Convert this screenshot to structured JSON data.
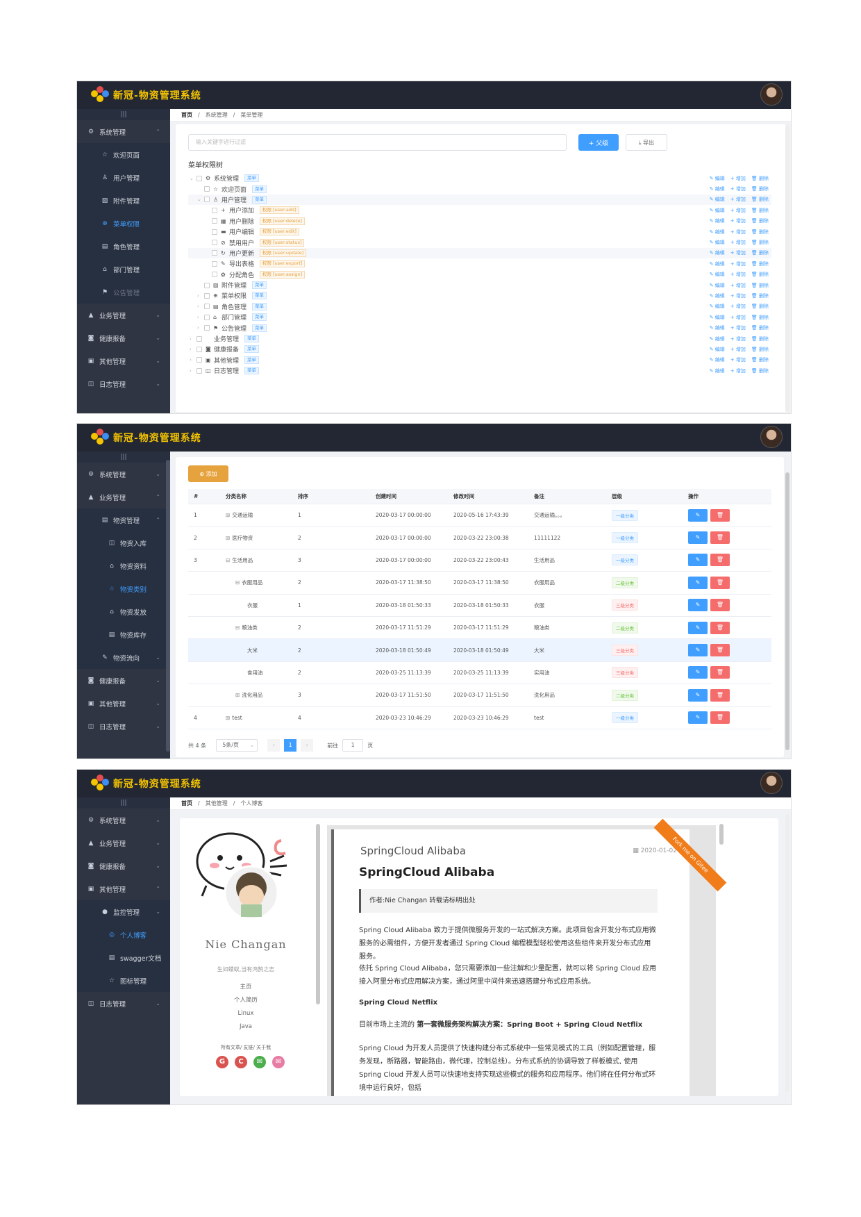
{
  "app": {
    "title": "新冠-物资管理系统"
  },
  "shot1": {
    "side_toggle": "|||",
    "menu": [
      {
        "label": "系统管理",
        "icon": "gear-icon",
        "level": 1,
        "arrow": "⌃"
      },
      {
        "label": "欢迎页面",
        "icon": "star-icon",
        "level": 2
      },
      {
        "label": "用户管理",
        "icon": "user-icon",
        "level": 2
      },
      {
        "label": "附件管理",
        "icon": "image-icon",
        "level": 2
      },
      {
        "label": "菜单权限",
        "icon": "globe-icon",
        "level": 2,
        "active": true
      },
      {
        "label": "角色管理",
        "icon": "id-card-icon",
        "level": 2
      },
      {
        "label": "部门管理",
        "icon": "home-icon",
        "level": 2
      },
      {
        "label": "公告管理",
        "icon": "flag-icon",
        "level": 2,
        "disabled": true
      },
      {
        "label": "业务管理",
        "icon": "bag-icon",
        "level": 1,
        "arrow": "⌄"
      },
      {
        "label": "健康报备",
        "icon": "camera-icon",
        "level": 1,
        "arrow": "⌄"
      },
      {
        "label": "其他管理",
        "icon": "picture-icon",
        "level": 1,
        "arrow": "⌄"
      },
      {
        "label": "日志管理",
        "icon": "calendar-icon",
        "level": 1,
        "arrow": "⌄"
      }
    ],
    "breadcrumb": [
      "首页",
      "系统管理",
      "菜单管理"
    ],
    "search_placeholder": "输入关键字进行过滤",
    "add_parent_label": "+ 父级",
    "export_label": "⤓ 导出",
    "tree_title": "菜单权限树",
    "ops": {
      "edit": "编辑",
      "add": "增加",
      "del": "删除"
    },
    "tree": [
      {
        "label": "系统管理",
        "icon": "⚙",
        "tag": "菜单",
        "depth": 0,
        "caret": "⌄"
      },
      {
        "label": "欢迎页面",
        "icon": "☆",
        "tag": "菜单",
        "depth": 1
      },
      {
        "label": "用户管理",
        "icon": "♙",
        "tag": "菜单",
        "depth": 1,
        "caret": "⌄",
        "hl": true
      },
      {
        "label": "用户添加",
        "icon": "+",
        "tag": "权限 [user:add]",
        "depth": 2,
        "perm": true
      },
      {
        "label": "用户删除",
        "icon": "▦",
        "tag": "权限 [user:delete]",
        "depth": 2,
        "perm": true
      },
      {
        "label": "用户编辑",
        "icon": "▬",
        "tag": "权限 [user:edit]",
        "depth": 2,
        "perm": true
      },
      {
        "label": "禁用用户",
        "icon": "⊘",
        "tag": "权限 [user:status]",
        "depth": 2,
        "perm": true
      },
      {
        "label": "用户更新",
        "icon": "↻",
        "tag": "权限 [user:update]",
        "depth": 2,
        "perm": true,
        "hl": true
      },
      {
        "label": "导出表格",
        "icon": "✎",
        "tag": "权限 [user:export]",
        "depth": 2,
        "perm": true
      },
      {
        "label": "分配角色",
        "icon": "✿",
        "tag": "权限 [user:assign]",
        "depth": 2,
        "perm": true
      },
      {
        "label": "附件管理",
        "icon": "▨",
        "tag": "菜单",
        "depth": 1
      },
      {
        "label": "菜单权限",
        "icon": "⊕",
        "tag": "菜单",
        "depth": 1,
        "caret": "›"
      },
      {
        "label": "角色管理",
        "icon": "▤",
        "tag": "菜单",
        "depth": 1,
        "caret": "›"
      },
      {
        "label": "部门管理",
        "icon": "⌂",
        "tag": "菜单",
        "depth": 1,
        "caret": "›"
      },
      {
        "label": "公告管理",
        "icon": "⚑",
        "tag": "菜单",
        "depth": 1,
        "caret": "›"
      },
      {
        "label": "业务管理",
        "icon": "",
        "tag": "菜单",
        "depth": 0,
        "caret": "›"
      },
      {
        "label": "健康报备",
        "icon": "◙",
        "tag": "菜单",
        "depth": 0,
        "caret": "›"
      },
      {
        "label": "其他管理",
        "icon": "▣",
        "tag": "菜单",
        "depth": 0,
        "caret": "›"
      },
      {
        "label": "日志管理",
        "icon": "◫",
        "tag": "菜单",
        "depth": 0,
        "caret": "›"
      }
    ]
  },
  "shot2": {
    "side_toggle": "|||",
    "menu": [
      {
        "label": "系统管理",
        "icon": "gear-icon",
        "level": 1,
        "arrow": "⌄"
      },
      {
        "label": "业务管理",
        "icon": "bag-icon",
        "level": 1,
        "arrow": "⌃"
      },
      {
        "label": "物资管理",
        "icon": "box-icon",
        "level": 2,
        "arrow": "⌃"
      },
      {
        "label": "物资入库",
        "icon": "calendar-icon",
        "level": 3
      },
      {
        "label": "物资资料",
        "icon": "lock-icon",
        "level": 3
      },
      {
        "label": "物资类别",
        "icon": "star-icon",
        "level": 3,
        "active": true
      },
      {
        "label": "物资发放",
        "icon": "lock-icon",
        "level": 3
      },
      {
        "label": "物资库存",
        "icon": "doc-icon",
        "level": 3
      },
      {
        "label": "物资流向",
        "icon": "edit-icon",
        "level": 2,
        "arrow": "⌄"
      },
      {
        "label": "健康报备",
        "icon": "camera-icon",
        "level": 1,
        "arrow": "⌄"
      },
      {
        "label": "其他管理",
        "icon": "picture-icon",
        "level": 1,
        "arrow": "⌄"
      },
      {
        "label": "日志管理",
        "icon": "calendar-icon",
        "level": 1,
        "arrow": "⌄"
      }
    ],
    "add_label": "⊕ 添加",
    "columns": [
      "#",
      "分类名称",
      "排序",
      "创建时间",
      "修改时间",
      "备注",
      "层级",
      "操作"
    ],
    "rows": [
      {
        "idx": "1",
        "name": "交通运输",
        "expand": "⊞",
        "indent": 0,
        "sort": "1",
        "created": "2020-03-17 00:00:00",
        "modified": "2020-05-16 17:43:39",
        "remark": "交通运输。。。",
        "level": "一级分类",
        "lv": 1
      },
      {
        "idx": "2",
        "name": "医疗物资",
        "expand": "⊞",
        "indent": 0,
        "sort": "2",
        "created": "2020-03-17 00:00:00",
        "modified": "2020-03-22 23:00:38",
        "remark": "11111122",
        "level": "一级分类",
        "lv": 1
      },
      {
        "idx": "3",
        "name": "生活用品",
        "expand": "⊟",
        "indent": 0,
        "sort": "3",
        "created": "2020-03-17 00:00:00",
        "modified": "2020-03-22 23:00:43",
        "remark": "生活用品",
        "level": "一级分类",
        "lv": 1
      },
      {
        "idx": "",
        "name": "衣服用品",
        "expand": "⊟",
        "indent": 1,
        "sort": "2",
        "created": "2020-03-17 11:38:50",
        "modified": "2020-03-17 11:38:50",
        "remark": "衣服用品",
        "level": "二级分类",
        "lv": 2
      },
      {
        "idx": "",
        "name": "衣服",
        "expand": "",
        "indent": 2,
        "sort": "1",
        "created": "2020-03-18 01:50:33",
        "modified": "2020-03-18 01:50:33",
        "remark": "衣服",
        "level": "三级分类",
        "lv": 3
      },
      {
        "idx": "",
        "name": "粮油类",
        "expand": "⊟",
        "indent": 1,
        "sort": "2",
        "created": "2020-03-17 11:51:29",
        "modified": "2020-03-17 11:51:29",
        "remark": "粮油类",
        "level": "二级分类",
        "lv": 2
      },
      {
        "idx": "",
        "name": "大米",
        "expand": "",
        "indent": 2,
        "sort": "2",
        "created": "2020-03-18 01:50:49",
        "modified": "2020-03-18 01:50:49",
        "remark": "大米",
        "level": "三级分类",
        "lv": 3,
        "hl": true
      },
      {
        "idx": "",
        "name": "食用油",
        "expand": "",
        "indent": 2,
        "sort": "2",
        "created": "2020-03-25 11:13:39",
        "modified": "2020-03-25 11:13:39",
        "remark": "实用油",
        "level": "三级分类",
        "lv": 3
      },
      {
        "idx": "",
        "name": "洗化用品",
        "expand": "⊞",
        "indent": 1,
        "sort": "3",
        "created": "2020-03-17 11:51:50",
        "modified": "2020-03-17 11:51:50",
        "remark": "洗化用品",
        "level": "二级分类",
        "lv": 2
      },
      {
        "idx": "4",
        "name": "test",
        "expand": "⊞",
        "indent": 0,
        "sort": "4",
        "created": "2020-03-23 10:46:29",
        "modified": "2020-03-23 10:46:29",
        "remark": "test",
        "level": "一级分类",
        "lv": 1
      }
    ],
    "pagination": {
      "total": "共 4 条",
      "page_size": "5条/页",
      "prev": "‹",
      "current": "1",
      "next": "›",
      "goto_label": "前往",
      "goto_value": "1",
      "page_unit": "页"
    },
    "edit_icon": "✎",
    "delete_icon": "🗑"
  },
  "shot3": {
    "side_toggle": "|||",
    "menu": [
      {
        "label": "系统管理",
        "icon": "gear-icon",
        "level": 1,
        "arrow": "⌄"
      },
      {
        "label": "业务管理",
        "icon": "bag-icon",
        "level": 1,
        "arrow": "⌄"
      },
      {
        "label": "健康报备",
        "icon": "camera-icon",
        "level": 1,
        "arrow": "⌄"
      },
      {
        "label": "其他管理",
        "icon": "picture-icon",
        "level": 1,
        "arrow": "⌃"
      },
      {
        "label": "监控管理",
        "icon": "info-icon",
        "level": 2,
        "arrow": "⌄"
      },
      {
        "label": "个人博客",
        "icon": "eye-icon",
        "level": 3,
        "active": true
      },
      {
        "label": "swagger文档",
        "icon": "doc-icon",
        "level": 3
      },
      {
        "label": "图标管理",
        "icon": "star-icon",
        "level": 3
      },
      {
        "label": "日志管理",
        "icon": "calendar-icon",
        "level": 1,
        "arrow": "⌄"
      }
    ],
    "breadcrumb": [
      "首页",
      "其他管理",
      "个人博客"
    ],
    "profile": {
      "name": "Nie Changan",
      "motto": "生如蝼蚁,当有鸿鹄之志",
      "links": [
        "主页",
        "个人简历",
        "Linux",
        "Java"
      ],
      "footer_links": "所有文章/ 友链/ 关于我"
    },
    "ribbon": "Fork me on Gitee",
    "post": {
      "category": "SpringCloud Alibaba",
      "date": "2020-01-02",
      "title": "SpringCloud Alibaba",
      "author_note": "作者:Nie Changan 转载请标明出处",
      "p1": "Spring Cloud Alibaba 致力于提供微服务开发的一站式解决方案。此项目包含开发分布式应用微服务的必需组件，方便开发者通过 Spring Cloud 编程模型轻松使用这些组件来开发分布式应用服务。",
      "p2": "依托 Spring Cloud Alibaba，您只需要添加一些注解和少量配置，就可以将 Spring Cloud 应用接入阿里分布式应用解决方案，通过阿里中间件来迅速搭建分布式应用系统。",
      "h_netflix": "Spring Cloud Netflix",
      "p3_prefix": "目前市场上主流的",
      "p3_bold": "第一套微服务架构解决方案：Spring Boot + Spring Cloud Netflix",
      "p4": "Spring Cloud 为开发人员提供了快速构建分布式系统中一些常见模式的工具（例如配置管理，服务发现，断路器，智能路由，微代理，控制总线）。分布式系统的协调导致了样板模式, 使用 Spring Cloud 开发人员可以快速地支持实现这些模式的服务和应用程序。他们将在任何分布式环境中运行良好，包括"
    }
  },
  "colors": {
    "primary": "#409eff",
    "danger": "#f56c6c",
    "warning": "#e6a23c",
    "sidebar": "#2f3542",
    "header": "#222733"
  }
}
